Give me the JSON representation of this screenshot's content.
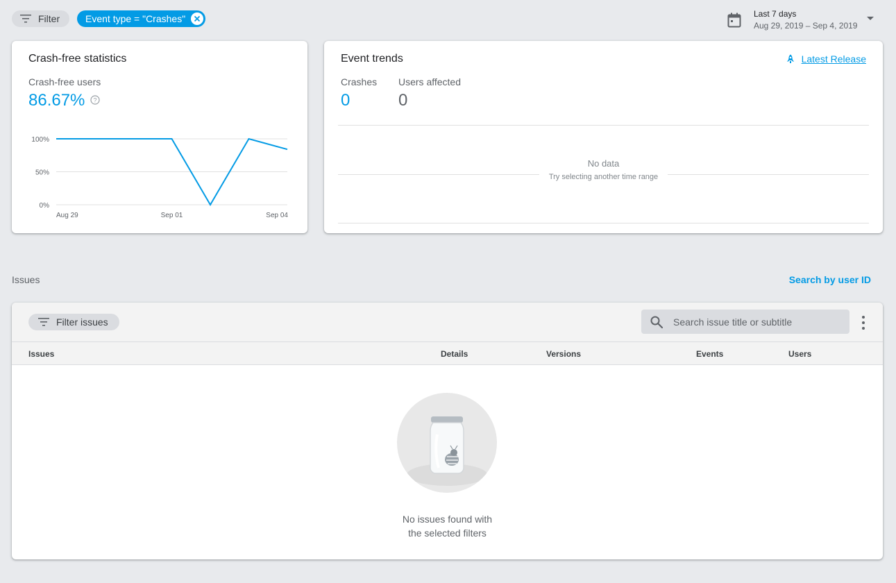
{
  "topbar": {
    "filter_label": "Filter",
    "chip_label": "Event type = \"Crashes\"",
    "date_range_title": "Last 7 days",
    "date_range_dates": "Aug 29, 2019 – Sep 4, 2019"
  },
  "crash_card": {
    "title": "Crash-free statistics",
    "metric_label": "Crash-free users",
    "metric_value": "86.67%"
  },
  "chart_data": {
    "type": "line",
    "title": "",
    "xlabel": "",
    "ylabel": "",
    "x": [
      "Aug 29",
      "Aug 30",
      "Aug 31",
      "Sep 01",
      "Sep 02",
      "Sep 03",
      "Sep 04"
    ],
    "x_tick_labels": [
      "Aug 29",
      "Sep 01",
      "Sep 04"
    ],
    "y_tick_labels": [
      "100%",
      "50%",
      "0%"
    ],
    "ylim": [
      0,
      100
    ],
    "grid": true,
    "series": [
      {
        "values": [
          100,
          100,
          100,
          100,
          0,
          100,
          84
        ],
        "color": "#039be5"
      }
    ]
  },
  "trends_card": {
    "title": "Event trends",
    "latest_release": "Latest Release",
    "crashes_label": "Crashes",
    "crashes_value": "0",
    "users_label": "Users affected",
    "users_value": "0",
    "no_data": "No data",
    "no_data_hint": "Try selecting another time range"
  },
  "issues": {
    "heading": "Issues",
    "search_user": "Search by user ID",
    "filter_label": "Filter issues",
    "search_placeholder": "Search issue title or subtitle",
    "columns": [
      "Issues",
      "Details",
      "Versions",
      "Events",
      "Users"
    ],
    "empty_line1": "No issues found with",
    "empty_line2": "the selected filters"
  },
  "colors": {
    "accent": "#039be5",
    "background": "#e8eaed"
  }
}
